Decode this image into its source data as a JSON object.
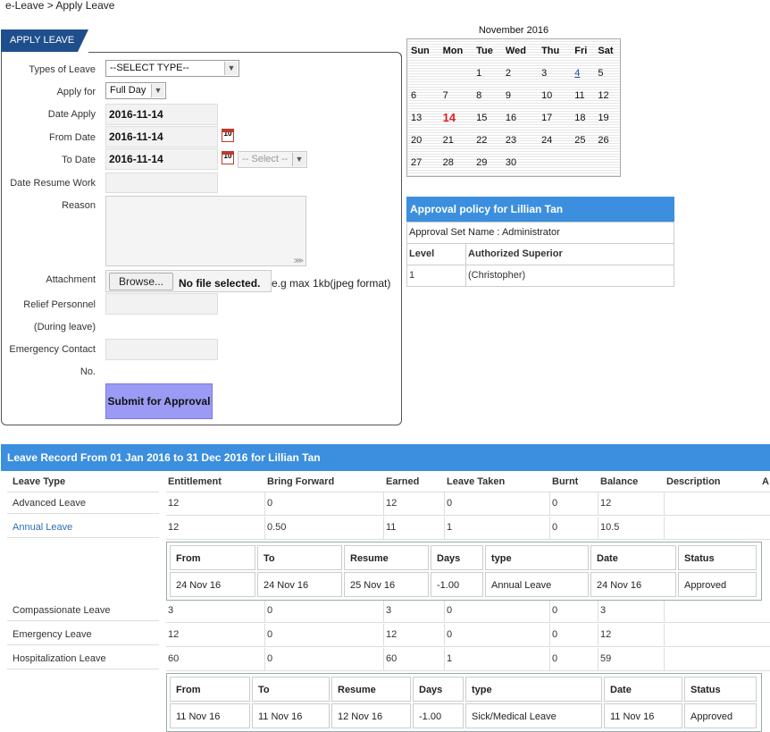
{
  "breadcrumb": "e-Leave > Apply Leave",
  "form": {
    "tab_label": "APPLY LEAVE",
    "labels": {
      "types": "Types of Leave",
      "apply_for": "Apply for",
      "date_apply": "Date Apply",
      "from_date": "From Date",
      "to_date": "To Date",
      "resume": "Date Resume Work",
      "reason": "Reason",
      "attachment": "Attachment",
      "relief1": "Relief Personnel",
      "relief2": "(During leave)",
      "emergency1": "Emergency Contact",
      "emergency2": "No."
    },
    "types_value": "--SELECT TYPE--",
    "apply_for_value": "Full Day",
    "date_apply": "2016-11-14",
    "from_date": "2016-11-14",
    "to_date": "2016-11-14",
    "to_select": "-- Select --",
    "browse_label": "Browse...",
    "no_file": "No file selected.",
    "attachment_hint": "e.g max 1kb(jpeg format)",
    "submit_label": "Submit for Approval",
    "cal_icon_text": "10"
  },
  "calendar": {
    "title": "November 2016",
    "days": [
      "Sun",
      "Mon",
      "Tue",
      "Wed",
      "Thu",
      "Fri",
      "Sat"
    ],
    "weeks": [
      [
        "",
        "",
        "1",
        "2",
        "3",
        "4",
        "5"
      ],
      [
        "6",
        "7",
        "8",
        "9",
        "10",
        "11",
        "12"
      ],
      [
        "13",
        "14",
        "15",
        "16",
        "17",
        "18",
        "19"
      ],
      [
        "20",
        "21",
        "22",
        "23",
        "24",
        "25",
        "26"
      ],
      [
        "27",
        "28",
        "29",
        "30",
        "",
        "",
        ""
      ]
    ],
    "today": "14",
    "linked_day": "4",
    "today_color": "#e02020"
  },
  "policy": {
    "title": "Approval policy for Lillian Tan",
    "set_name": "Approval Set Name : Administrator",
    "col_level": "Level",
    "col_superior": "Authorized Superior",
    "level": "1",
    "superior": "(Christopher)"
  },
  "record": {
    "title": "Leave Record From 01 Jan 2016 to 31 Dec 2016 for Lillian Tan",
    "columns": [
      "Leave Type",
      "Entitlement",
      "Bring Forward",
      "Earned",
      "Leave Taken",
      "Burnt",
      "Balance",
      "Description",
      "A"
    ],
    "rows": [
      {
        "name": "Advanced Leave",
        "entitlement": "12",
        "bring_forward": "0",
        "earned": "12",
        "taken": "0",
        "burnt": "0",
        "balance": "12"
      },
      {
        "name": "Annual Leave",
        "entitlement": "12",
        "bring_forward": "0.50",
        "earned": "11",
        "taken": "1",
        "burnt": "0",
        "balance": "10.5"
      },
      {
        "name": "Compassionate Leave",
        "entitlement": "3",
        "bring_forward": "0",
        "earned": "3",
        "taken": "0",
        "burnt": "0",
        "balance": "3"
      },
      {
        "name": "Emergency Leave",
        "entitlement": "12",
        "bring_forward": "0",
        "earned": "12",
        "taken": "0",
        "burnt": "0",
        "balance": "12"
      },
      {
        "name": "Hospitalization Leave",
        "entitlement": "60",
        "bring_forward": "0",
        "earned": "60",
        "taken": "1",
        "burnt": "0",
        "balance": "59"
      }
    ],
    "detail_columns": [
      "From",
      "To",
      "Resume",
      "Days",
      "type",
      "Date",
      "Status"
    ],
    "detail_annual": [
      "24 Nov 16",
      "24 Nov 16",
      "25 Nov 16",
      "-1.00",
      "Annual Leave",
      "24 Nov 16",
      "Approved"
    ],
    "detail_hosp": [
      "11 Nov 16",
      "11 Nov 16",
      "12 Nov 16",
      "-1.00",
      "Sick/Medical Leave",
      "11 Nov 16",
      "Approved"
    ]
  }
}
